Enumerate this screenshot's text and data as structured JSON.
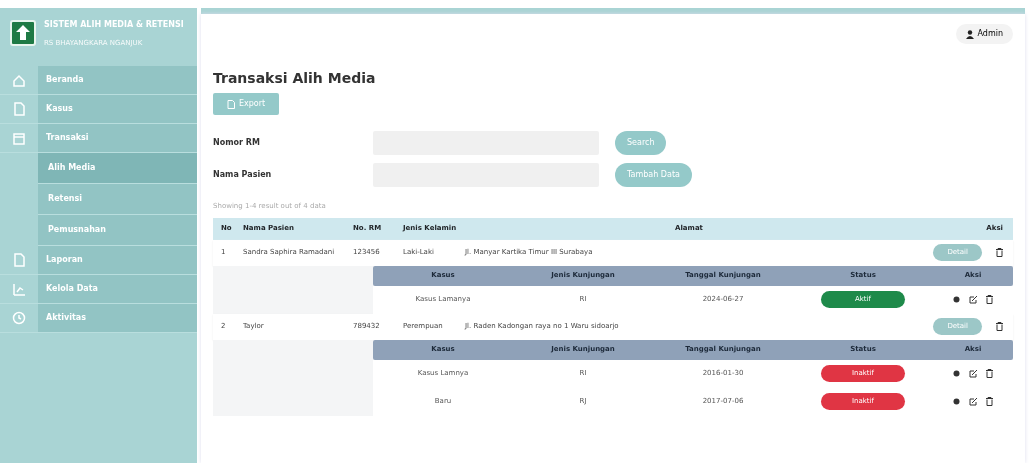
{
  "sidebar": {
    "title": "SISTEM ALIH MEDIA & RETENSI",
    "subtitle": "RS BHAYANGKARA NGANJUK",
    "items": [
      {
        "label": "Beranda",
        "selected": false
      },
      {
        "label": "Kasus",
        "selected": false
      },
      {
        "label": "Transaksi",
        "selected": false,
        "children": [
          {
            "label": "Alih Media",
            "selected": true
          },
          {
            "label": "Retensi",
            "selected": false
          },
          {
            "label": "Pemusnahan",
            "selected": false
          }
        ]
      },
      {
        "label": "Laporan",
        "selected": false
      },
      {
        "label": "Kelola Data",
        "selected": false
      },
      {
        "label": "Aktivitas",
        "selected": false
      }
    ]
  },
  "user": {
    "label": "Admin"
  },
  "page": {
    "title": "Transaksi Alih Media",
    "export_button": "Export"
  },
  "filters": [
    {
      "label": "Nomor RM",
      "button": "Search"
    },
    {
      "label": "Nama Pasien",
      "button": "Tambah Data"
    }
  ],
  "summary": "Showing 1-4 result out of 4 data",
  "table": {
    "columns": [
      "No",
      "Nama Pasien",
      "No. RM",
      "Jenis Kelamin",
      "Alamat",
      "Aksi"
    ],
    "rows": [
      {
        "no": "1",
        "name": "Sandra Saphira Ramadani",
        "rm": "123456",
        "gender": "Laki-Laki",
        "address": "Jl. Manyar Kartika Timur III Surabaya",
        "detail": "Detail",
        "sub_columns": [
          "Kasus",
          "Jenis Kunjungan",
          "Tanggal Kunjungan",
          "Status",
          "Aksi"
        ],
        "visits": [
          {
            "case": "Kasus Lamanya",
            "type": "RI",
            "date": "2024-06-27",
            "status": "Aktif",
            "color": "#1e8a4a"
          }
        ]
      },
      {
        "no": "2",
        "name": "Taylor",
        "rm": "789432",
        "gender": "Perempuan",
        "address": "Jl. Raden Kadongan raya no 1 Waru sidoarjo",
        "detail": "Detail",
        "sub_columns": [
          "Kasus",
          "Jenis Kunjungan",
          "Tanggal Kunjungan",
          "Status",
          "Aksi"
        ],
        "visits": [
          {
            "case": "Kasus Lamnya",
            "type": "RI",
            "date": "2016-01-30",
            "status": "Inaktif",
            "color": "#e03544"
          },
          {
            "case": "Baru",
            "type": "RJ",
            "date": "2017-07-06",
            "status": "Inaktif",
            "color": "#e03544"
          }
        ]
      }
    ]
  }
}
